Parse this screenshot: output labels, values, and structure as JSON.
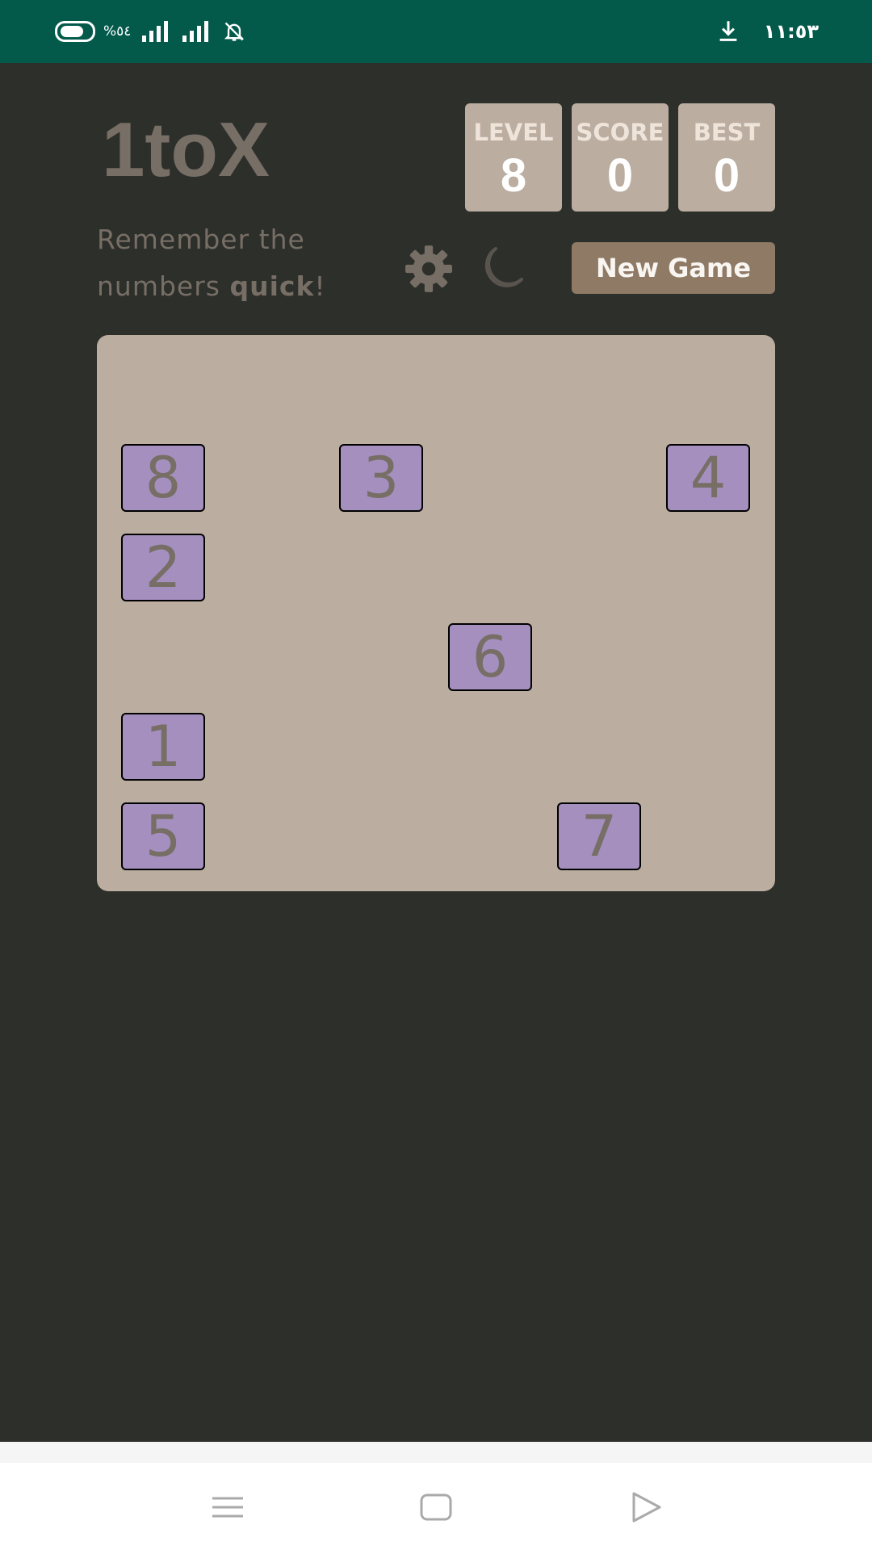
{
  "status_bar": {
    "battery_percent": "%٥٤",
    "time": "١١:٥٣",
    "icons": [
      "battery-icon",
      "signal-icon",
      "signal-icon",
      "bell-muted-icon",
      "download-icon"
    ]
  },
  "header": {
    "title": "1toX",
    "subtitle_part1": "Remember the numbers ",
    "subtitle_bold": "quick",
    "subtitle_end": "!"
  },
  "scores": {
    "level_label": "LEVEL",
    "level_value": "8",
    "score_label": "SCORE",
    "score_value": "0",
    "best_label": "BEST",
    "best_value": "0"
  },
  "controls": {
    "settings_icon": "gear-icon",
    "theme_icon": "moon-icon",
    "new_game_label": "New Game"
  },
  "board": {
    "columns": 6,
    "rows": 6,
    "tiles": [
      {
        "number": "8",
        "col": 0,
        "row": 1
      },
      {
        "number": "3",
        "col": 2,
        "row": 1
      },
      {
        "number": "4",
        "col": 5,
        "row": 1
      },
      {
        "number": "2",
        "col": 0,
        "row": 2
      },
      {
        "number": "6",
        "col": 3,
        "row": 3
      },
      {
        "number": "1",
        "col": 0,
        "row": 4
      },
      {
        "number": "5",
        "col": 0,
        "row": 5
      },
      {
        "number": "7",
        "col": 4,
        "row": 5
      }
    ]
  },
  "colors": {
    "status_bar": "#035a4b",
    "background": "#2d2f2b",
    "board": "#bbada0",
    "tile": "#a58fbf",
    "button": "#8f7a66",
    "text": "#776e65"
  },
  "nav_bar": {
    "buttons": [
      "menu-icon",
      "home-icon",
      "back-icon"
    ]
  }
}
